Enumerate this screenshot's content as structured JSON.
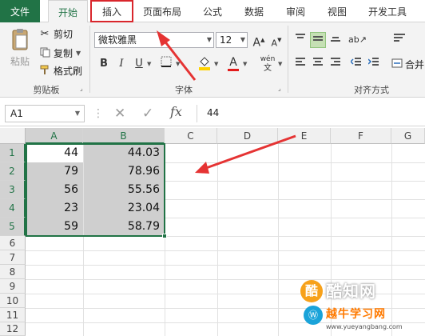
{
  "tabs": [
    "文件",
    "开始",
    "插入",
    "页面布局",
    "公式",
    "数据",
    "审阅",
    "视图",
    "开发工具"
  ],
  "clipboard": {
    "paste": "粘贴",
    "cut": "剪切",
    "copy": "复制",
    "format_painter": "格式刷",
    "group_label": "剪贴板"
  },
  "font": {
    "name": "微软雅黑",
    "size": "12",
    "grow": "A",
    "shrink": "A",
    "bold": "B",
    "italic": "I",
    "underline": "U",
    "font_color_glyph": "A",
    "phonetic_glyph": "wén",
    "group_label": "字体"
  },
  "alignment": {
    "group_label": "对齐方式",
    "merge_label": "合并"
  },
  "formula_bar": {
    "name_box": "A1",
    "cancel": "✕",
    "enter": "✓",
    "fx": "fx",
    "value": "44"
  },
  "columns": [
    "A",
    "B",
    "C",
    "D",
    "E",
    "F",
    "G"
  ],
  "rows": [
    "1",
    "2",
    "3",
    "4",
    "5",
    "6",
    "7",
    "8",
    "9",
    "10",
    "11",
    "12"
  ],
  "table": [
    {
      "a": "44",
      "b": "44.03"
    },
    {
      "a": "79",
      "b": "78.96"
    },
    {
      "a": "56",
      "b": "55.56"
    },
    {
      "a": "23",
      "b": "23.04"
    },
    {
      "a": "59",
      "b": "58.79"
    }
  ],
  "watermark": {
    "brand": "酷知网",
    "brand2": "越牛学习网",
    "url": "www.yueyangbang.com"
  },
  "colors": {
    "excel_green": "#217346",
    "highlight_red": "#d9262c",
    "selection_gray": "#cfcfcf"
  }
}
